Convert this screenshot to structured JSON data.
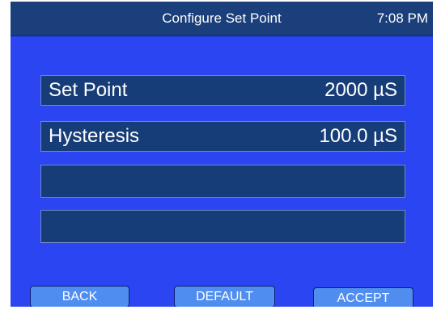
{
  "header": {
    "title": "Configure Set Point",
    "time": "7:08 PM"
  },
  "fields": [
    {
      "label": "Set Point",
      "value": "2000 µS"
    },
    {
      "label": "Hysteresis",
      "value": "100.0 µS"
    },
    {
      "label": "",
      "value": ""
    },
    {
      "label": "",
      "value": ""
    }
  ],
  "buttons": {
    "back": "BACK",
    "default": "DEFAULT",
    "accept": "ACCEPT"
  },
  "colors": {
    "screen_background": "#2b45f2",
    "title_bar": "#1b3f7a",
    "field_background": "#163d78",
    "button_background": "#4f8df0"
  }
}
